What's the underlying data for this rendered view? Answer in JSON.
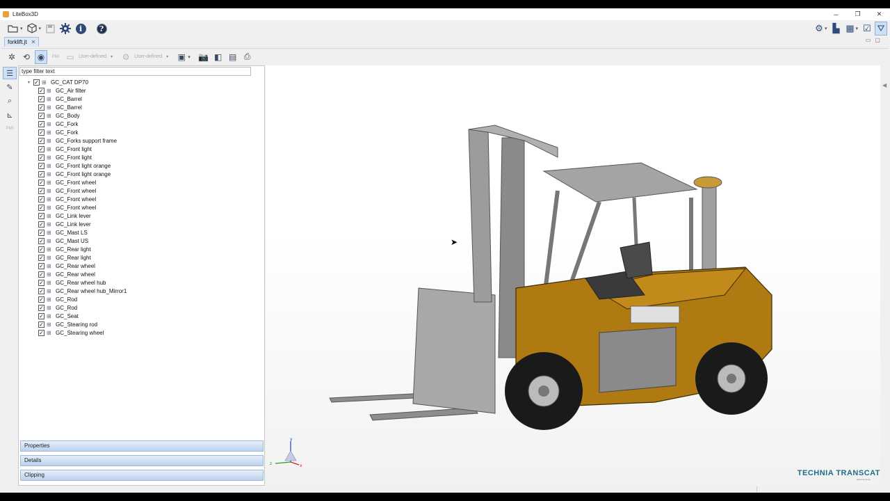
{
  "window": {
    "title": "LiteBox3D",
    "controls": [
      "─",
      "❐",
      "✕"
    ]
  },
  "toolbar": {
    "open_icon": "folder-open-icon",
    "package_icon": "package-icon",
    "save_icon": "save-icon",
    "settings_icon": "gear-icon",
    "info_label": "i",
    "help_label": "?"
  },
  "document_tab": {
    "label": "forklift.jt",
    "close": "✕"
  },
  "view_toolbar": {
    "dropdown1_label": "User-defined",
    "dropdown2_label": "User-defined",
    "pmi_label": "PMI"
  },
  "left_strip": {
    "pmi_label": "PMI"
  },
  "filter": {
    "value": "type filter text"
  },
  "tree": {
    "root": {
      "label": "GC_CAT DP70",
      "checked": "✓",
      "expander": "▾"
    },
    "items": [
      {
        "label": "GC_Air filter"
      },
      {
        "label": "GC_Barrel"
      },
      {
        "label": "GC_Barrel"
      },
      {
        "label": "GC_Body"
      },
      {
        "label": "GC_Fork"
      },
      {
        "label": "GC_Fork"
      },
      {
        "label": "GC_Forks support frame"
      },
      {
        "label": "GC_Front light"
      },
      {
        "label": "GC_Front light"
      },
      {
        "label": "GC_Front light orange"
      },
      {
        "label": "GC_Front light orange"
      },
      {
        "label": "GC_Front wheel"
      },
      {
        "label": "GC_Front wheel"
      },
      {
        "label": "GC_Front wheel"
      },
      {
        "label": "GC_Front wheel"
      },
      {
        "label": "GC_Link lever"
      },
      {
        "label": "GC_Link lever"
      },
      {
        "label": "GC_Mast LS"
      },
      {
        "label": "GC_Mast US"
      },
      {
        "label": "GC_Rear light"
      },
      {
        "label": "GC_Rear light"
      },
      {
        "label": "GC_Rear wheel"
      },
      {
        "label": "GC_Rear wheel"
      },
      {
        "label": "GC_Rear wheel hub"
      },
      {
        "label": "GC_Rear wheel hub_Mirror1"
      },
      {
        "label": "GC_Rod"
      },
      {
        "label": "GC_Rod"
      },
      {
        "label": "GC_Seat"
      },
      {
        "label": "GC_Stearing rod"
      },
      {
        "label": "GC_Stearing wheel"
      }
    ]
  },
  "panels": {
    "properties": "Properties",
    "details": "Details",
    "clipping": "Clipping"
  },
  "viewport": {
    "brand": "TECHNIA TRANSCAT",
    "brand_sub": "addnode group",
    "axis_labels": {
      "y": "y",
      "z": "z",
      "x": "x"
    },
    "model_colors": {
      "body": "#b07a12",
      "metal": "#9a9a9a",
      "tire": "#1a1a1a"
    }
  }
}
